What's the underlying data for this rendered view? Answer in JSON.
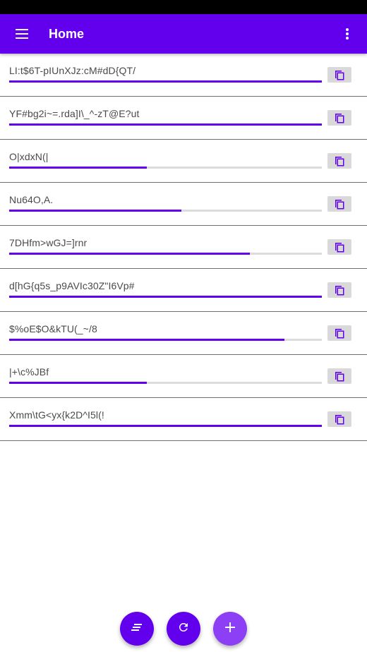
{
  "app_bar": {
    "title": "Home",
    "menu_icon": "hamburger-menu-icon",
    "more_icon": "more-vert-icon",
    "color": "#6200ee"
  },
  "items": [
    {
      "text": "LI:t$6T-pIUnXJz:cM#dD{QT/",
      "strength": 1.0
    },
    {
      "text": "YF#bg2i~=.rda]I\\_^-zT@E?ut",
      "strength": 1.0
    },
    {
      "text": "O|xdxN(|",
      "strength": 0.44
    },
    {
      "text": "Nu64O,A.",
      "strength": 0.55
    },
    {
      "text": "7DHfm>wGJ=]rnr",
      "strength": 0.77
    },
    {
      "text": "d[hG{q5s_p9AVIc30Z\"I6Vp#",
      "strength": 1.0
    },
    {
      "text": "$%oE$O&kTU(_~/8",
      "strength": 0.88
    },
    {
      "text": "|+\\c%JBf",
      "strength": 0.44
    },
    {
      "text": "Xmm\\tG<yx{k2D^I5l(!",
      "strength": 1.0
    }
  ],
  "copy_icon": "content-copy-icon",
  "fabs": [
    {
      "name": "sort-button",
      "icon": "sort-icon"
    },
    {
      "name": "refresh-button",
      "icon": "refresh-icon"
    },
    {
      "name": "add-button",
      "icon": "add-icon"
    }
  ]
}
